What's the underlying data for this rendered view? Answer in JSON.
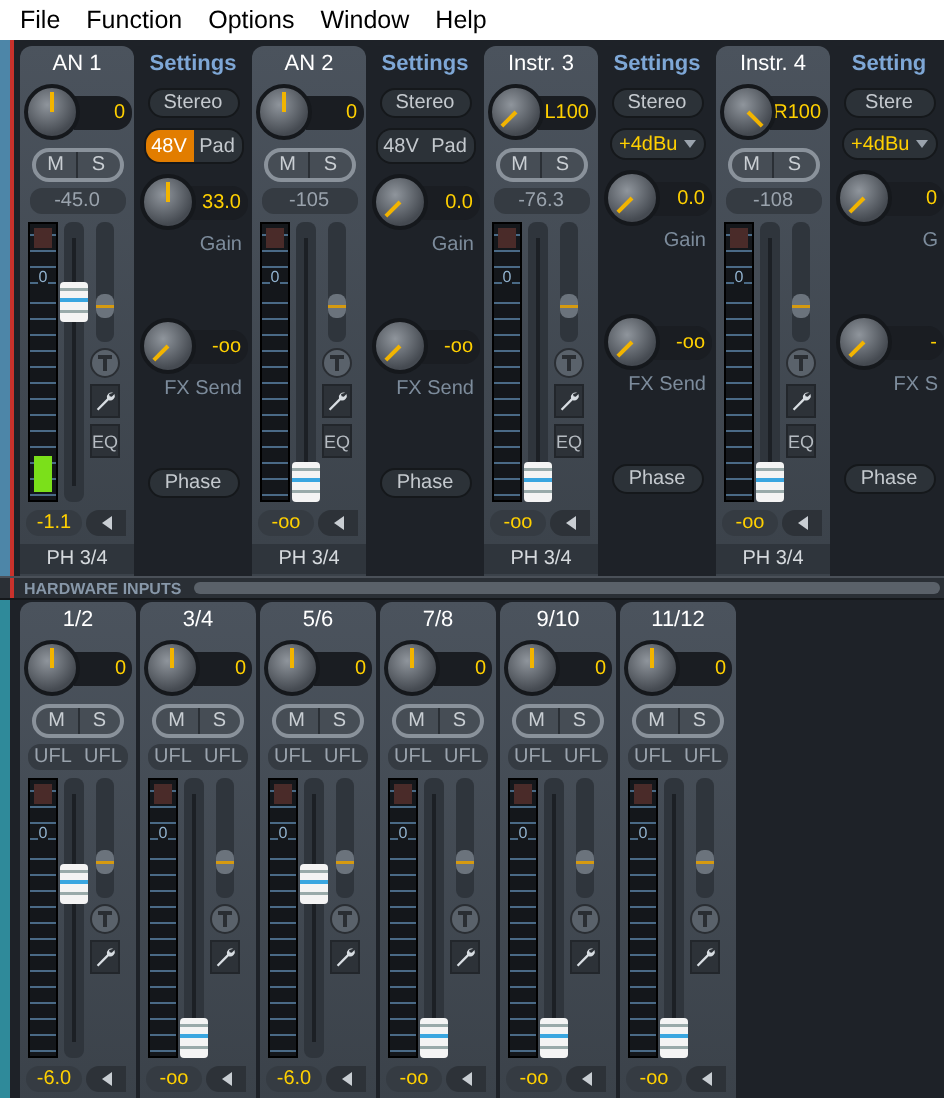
{
  "menu": [
    "File",
    "Function",
    "Options",
    "Window",
    "Help"
  ],
  "inputs": [
    {
      "name": "AN 1",
      "pan": {
        "value": "0",
        "kind": "center"
      },
      "mute": "M",
      "solo": "S",
      "readout": "-45.0",
      "scale": "0",
      "meter": {
        "level": 0.14
      },
      "fader": {
        "value": "-1.1",
        "level": 0.78
      },
      "trim": {
        "level": 0.25
      },
      "eq": "EQ",
      "routing": "PH 3/4",
      "settings": {
        "title": "Settings",
        "stereo": "Stereo",
        "kind": "mic",
        "options": [
          {
            "label": "48V",
            "on": true
          },
          {
            "label": "Pad",
            "on": false
          }
        ],
        "gain": {
          "value": "33.0",
          "kind": "center"
        },
        "gain_label": "Gain",
        "fx": {
          "value": "-oo",
          "kind": "min"
        },
        "fx_label": "FX Send",
        "phase": "Phase"
      }
    },
    {
      "name": "AN 2",
      "pan": {
        "value": "0",
        "kind": "center"
      },
      "mute": "M",
      "solo": "S",
      "readout": "-105",
      "scale": "0",
      "fader": {
        "value": "-oo",
        "level": 0
      },
      "trim": {
        "level": 0.25
      },
      "eq": "EQ",
      "routing": "PH 3/4",
      "settings": {
        "title": "Settings",
        "stereo": "Stereo",
        "kind": "mic",
        "options": [
          {
            "label": "48V",
            "on": false
          },
          {
            "label": "Pad",
            "on": false
          }
        ],
        "gain": {
          "value": "0.0",
          "kind": "min"
        },
        "gain_label": "Gain",
        "fx": {
          "value": "-oo",
          "kind": "min"
        },
        "fx_label": "FX Send",
        "phase": "Phase"
      }
    },
    {
      "name": "Instr. 3",
      "pan": {
        "value": "L100",
        "kind": "min"
      },
      "mute": "M",
      "solo": "S",
      "readout": "-76.3",
      "scale": "0",
      "fader": {
        "value": "-oo",
        "level": 0
      },
      "trim": {
        "level": 0.25
      },
      "eq": "EQ",
      "routing": "PH 3/4",
      "settings": {
        "title": "Settings",
        "stereo": "Stereo",
        "kind": "inst",
        "line_level": "+4dBu",
        "gain": {
          "value": "0.0",
          "kind": "min"
        },
        "gain_label": "Gain",
        "fx": {
          "value": "-oo",
          "kind": "min"
        },
        "fx_label": "FX Send",
        "phase": "Phase"
      }
    },
    {
      "name": "Instr. 4",
      "pan": {
        "value": "R100",
        "kind": "max"
      },
      "mute": "M",
      "solo": "S",
      "readout": "-108",
      "scale": "0",
      "fader": {
        "value": "-oo",
        "level": 0
      },
      "trim": {
        "level": 0.25
      },
      "eq": "EQ",
      "routing": "PH 3/4",
      "settings": {
        "title": "Setting",
        "stereo": "Stere",
        "kind": "inst",
        "line_level": "+4dBu",
        "gain": {
          "value": "0",
          "kind": "min"
        },
        "gain_label": "G",
        "fx": {
          "value": "-",
          "kind": "min"
        },
        "fx_label": "FX S",
        "phase": "Phase"
      }
    }
  ],
  "section_label": "HARDWARE INPUTS",
  "hardware": [
    {
      "name": "1/2",
      "pan": {
        "value": "0",
        "kind": "center"
      },
      "mute": "M",
      "solo": "S",
      "flags": [
        "UFL",
        "UFL"
      ],
      "scale": "0",
      "fader": {
        "value": "-6.0",
        "level": 0.66
      },
      "trim": {
        "level": 0.25
      }
    },
    {
      "name": "3/4",
      "pan": {
        "value": "0",
        "kind": "center"
      },
      "mute": "M",
      "solo": "S",
      "flags": [
        "UFL",
        "UFL"
      ],
      "scale": "0",
      "fader": {
        "value": "-oo",
        "level": 0
      },
      "trim": {
        "level": 0.25
      }
    },
    {
      "name": "5/6",
      "pan": {
        "value": "0",
        "kind": "center"
      },
      "mute": "M",
      "solo": "S",
      "flags": [
        "UFL",
        "UFL"
      ],
      "scale": "0",
      "fader": {
        "value": "-6.0",
        "level": 0.66
      },
      "trim": {
        "level": 0.25
      }
    },
    {
      "name": "7/8",
      "pan": {
        "value": "0",
        "kind": "center"
      },
      "mute": "M",
      "solo": "S",
      "flags": [
        "UFL",
        "UFL"
      ],
      "scale": "0",
      "fader": {
        "value": "-oo",
        "level": 0
      },
      "trim": {
        "level": 0.25
      }
    },
    {
      "name": "9/10",
      "pan": {
        "value": "0",
        "kind": "center"
      },
      "mute": "M",
      "solo": "S",
      "flags": [
        "UFL",
        "UFL"
      ],
      "scale": "0",
      "fader": {
        "value": "-oo",
        "level": 0
      },
      "trim": {
        "level": 0.25
      }
    },
    {
      "name": "11/12",
      "pan": {
        "value": "0",
        "kind": "center"
      },
      "mute": "M",
      "solo": "S",
      "flags": [
        "UFL",
        "UFL"
      ],
      "scale": "0",
      "fader": {
        "value": "-oo",
        "level": 0
      },
      "trim": {
        "level": 0.25
      }
    }
  ]
}
